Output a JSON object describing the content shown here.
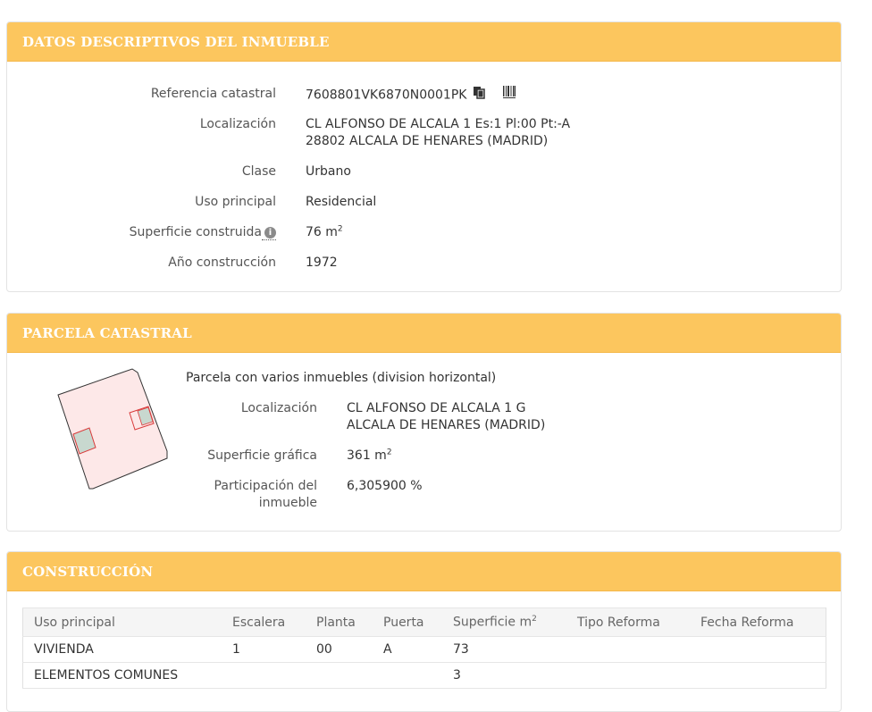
{
  "datos": {
    "heading": "DATOS DESCRIPTIVOS DEL INMUEBLE",
    "referencia_label": "Referencia catastral",
    "referencia_value": "7608801VK6870N0001PK",
    "localizacion_label": "Localización",
    "localizacion_line1": "CL ALFONSO DE ALCALA 1 Es:1 Pl:00 Pt:-A",
    "localizacion_line2": "28802 ALCALA DE HENARES (MADRID)",
    "clase_label": "Clase",
    "clase_value": "Urbano",
    "uso_label": "Uso principal",
    "uso_value": "Residencial",
    "superficie_label": "Superficie construida",
    "superficie_value": "76 m",
    "superficie_sup": "2",
    "anio_label": "Año construcción",
    "anio_value": "1972",
    "icons": [
      "copy-icon",
      "barcode-icon",
      "info-icon"
    ]
  },
  "parcela": {
    "heading": "PARCELA CATASTRAL",
    "descripcion": "Parcela con varios inmuebles (division horizontal)",
    "localizacion_label": "Localización",
    "localizacion_line1": "CL ALFONSO DE ALCALA 1 G",
    "localizacion_line2": "ALCALA DE HENARES (MADRID)",
    "superficie_label": "Superficie gráfica",
    "superficie_value": "361 m",
    "superficie_sup": "2",
    "participacion_label_1": "Participación del",
    "participacion_label_2": "inmueble",
    "participacion_value": "6,305900 %",
    "map_colors": {
      "parcel_fill": "#fde8e8",
      "unit_fill": "#c8d8cf",
      "unit_stroke": "#d93a3a"
    }
  },
  "construccion": {
    "heading": "CONSTRUCCIÓN",
    "columns": [
      "Uso principal",
      "Escalera",
      "Planta",
      "Puerta",
      "Superficie m",
      "Tipo Reforma",
      "Fecha Reforma"
    ],
    "superficie_col_sup": "2",
    "rows": [
      [
        "VIVIENDA",
        "1",
        "00",
        "A",
        "73",
        "",
        ""
      ],
      [
        "ELEMENTOS COMUNES",
        "",
        "",
        "",
        "3",
        "",
        ""
      ]
    ]
  },
  "colors": {
    "heading_bg": "#fcc65e",
    "heading_text": "#ffffff"
  }
}
